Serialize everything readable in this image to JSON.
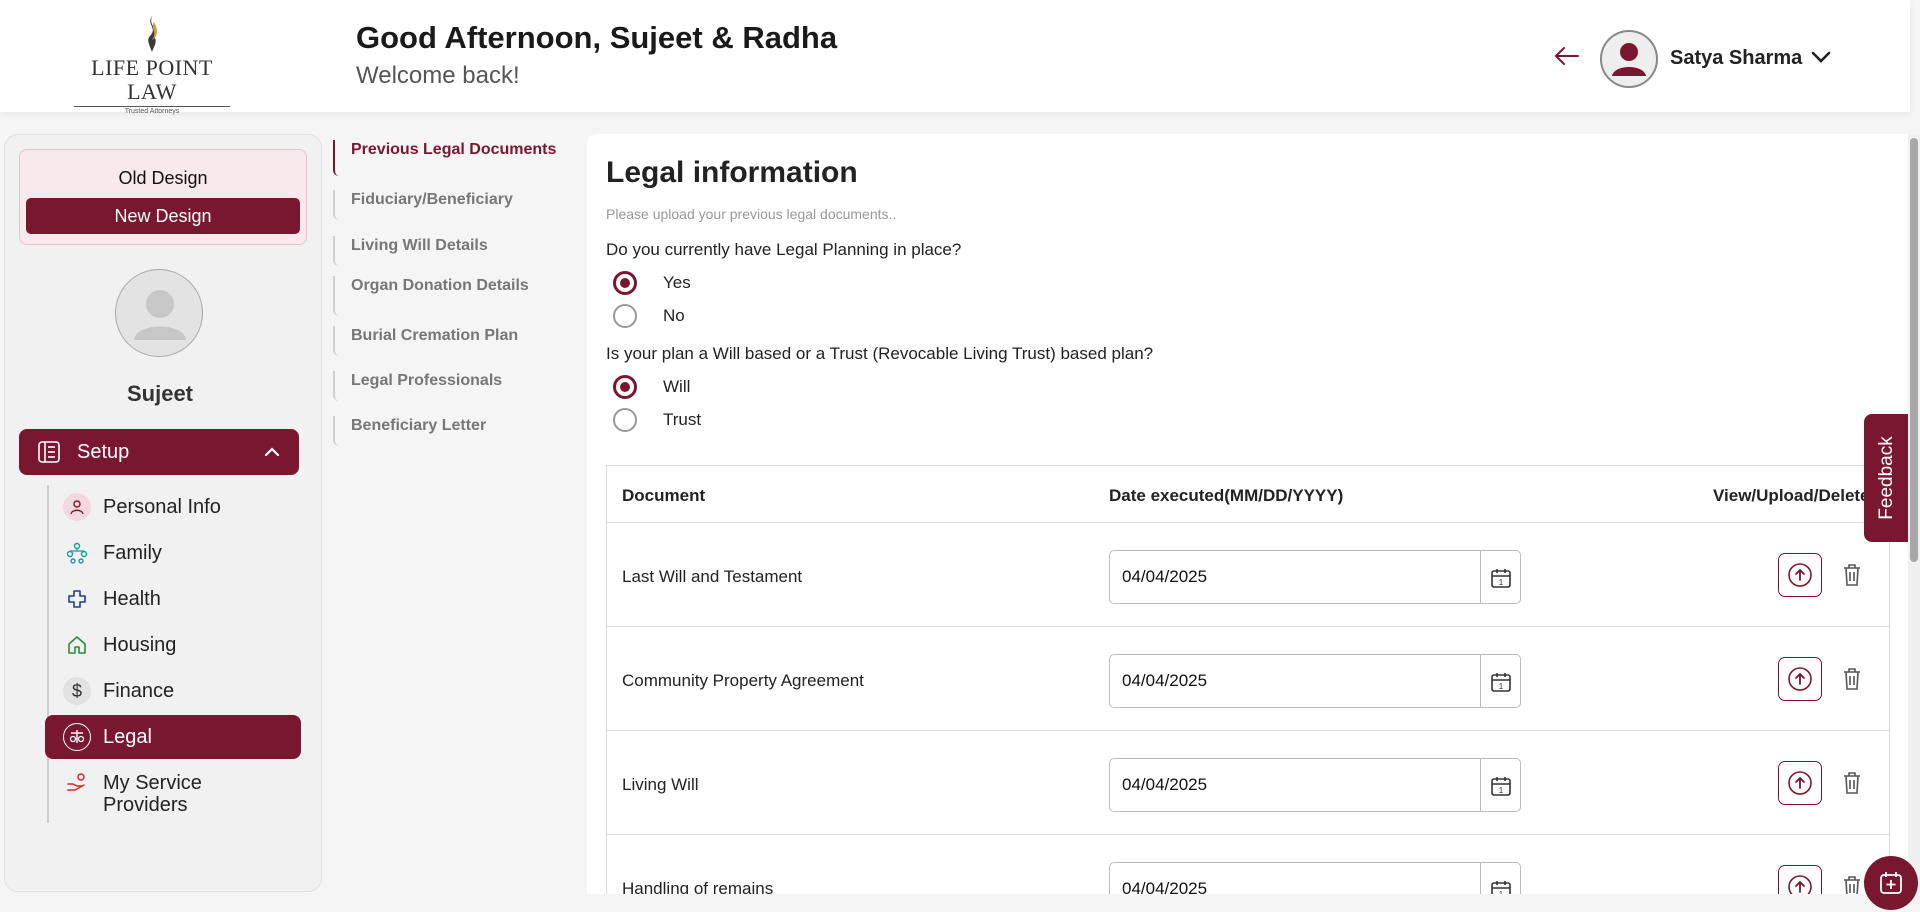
{
  "header": {
    "logo_text": "LIFE POINT LAW",
    "logo_tagline": "Trusted Attorneys",
    "greeting": "Good Afternoon, Sujeet & Radha",
    "welcome": "Welcome back!",
    "user_name": "Satya Sharma"
  },
  "sidebar": {
    "old_design": "Old Design",
    "new_design": "New Design",
    "profile_name": "Sujeet",
    "setup_label": "Setup",
    "items": [
      {
        "label": "Personal Info",
        "icon": "person-icon"
      },
      {
        "label": "Family",
        "icon": "family-tree-icon"
      },
      {
        "label": "Health",
        "icon": "health-cross-icon"
      },
      {
        "label": "Housing",
        "icon": "house-icon"
      },
      {
        "label": "Finance",
        "icon": "dollar-icon"
      },
      {
        "label": "Legal",
        "icon": "scales-icon"
      },
      {
        "label": "My Service Providers",
        "icon": "service-provider-icon"
      }
    ]
  },
  "subnav": {
    "items": [
      "Previous Legal Documents",
      "Fiduciary/Beneficiary",
      "Living Will Details",
      "Organ Donation Details",
      "Burial Cremation Plan",
      "Legal Professionals",
      "Beneficiary Letter"
    ],
    "active_index": 0
  },
  "main": {
    "title": "Legal information",
    "subtitle": "Please upload your previous legal documents..",
    "question1": "Do you currently have Legal Planning in place?",
    "q1_options": [
      "Yes",
      "No"
    ],
    "q1_selected": "Yes",
    "question2": "Is your plan a Will based or a Trust (Revocable Living Trust) based plan?",
    "q2_options": [
      "Will",
      "Trust"
    ],
    "q2_selected": "Will",
    "table": {
      "headers": [
        "Document",
        "Date executed(MM/DD/YYYY)",
        "View/Upload/Delete"
      ],
      "rows": [
        {
          "document": "Last Will and Testament",
          "date": "04/04/2025"
        },
        {
          "document": "Community Property Agreement",
          "date": "04/04/2025"
        },
        {
          "document": "Living Will",
          "date": "04/04/2025"
        },
        {
          "document": "Handling of remains",
          "date": "04/04/2025"
        }
      ]
    }
  },
  "feedback_label": "Feedback",
  "colors": {
    "brand": "#7a1730",
    "muted": "#777777"
  }
}
